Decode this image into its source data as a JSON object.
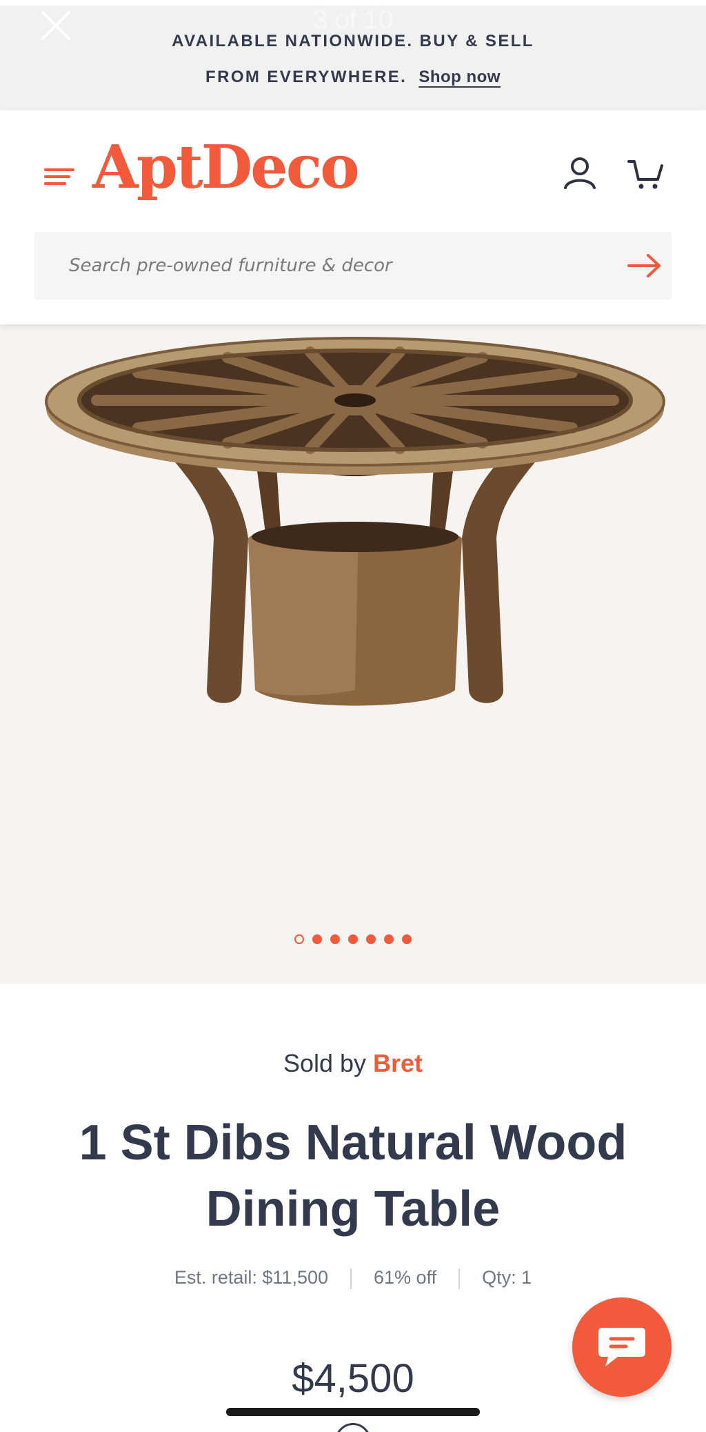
{
  "viewer": {
    "counter": "3 of 10"
  },
  "banner": {
    "line1": "AVAILABLE NATIONWIDE. BUY & SELL",
    "line2": "FROM EVERYWHERE.",
    "link": "Shop now"
  },
  "header": {
    "logo": "AptDeco",
    "search_placeholder": "Search pre-owned furniture & decor"
  },
  "icons": {
    "close": "close-icon",
    "menu": "hamburger-menu-icon",
    "account": "user-icon",
    "cart": "cart-icon",
    "search_submit": "arrow-right-icon",
    "chat": "chat-bubble-icon"
  },
  "gallery": {
    "image_alt": "1 St Dibs Natural Wood Dining Table",
    "dots_total": 7,
    "active_dot": 1
  },
  "product": {
    "sold_by_label": "Sold by",
    "seller": "Bret",
    "title": "1 St Dibs Natural Wood Dining Table",
    "est_retail": "Est. retail: $11,500",
    "discount": "61% off",
    "qty": "Qty: 1",
    "price": "$4,500"
  },
  "colors": {
    "brand": "#f15a3a",
    "text": "#333a4d",
    "banner_bg": "#f1f1f2",
    "gallery_bg": "#f6f3f0"
  }
}
